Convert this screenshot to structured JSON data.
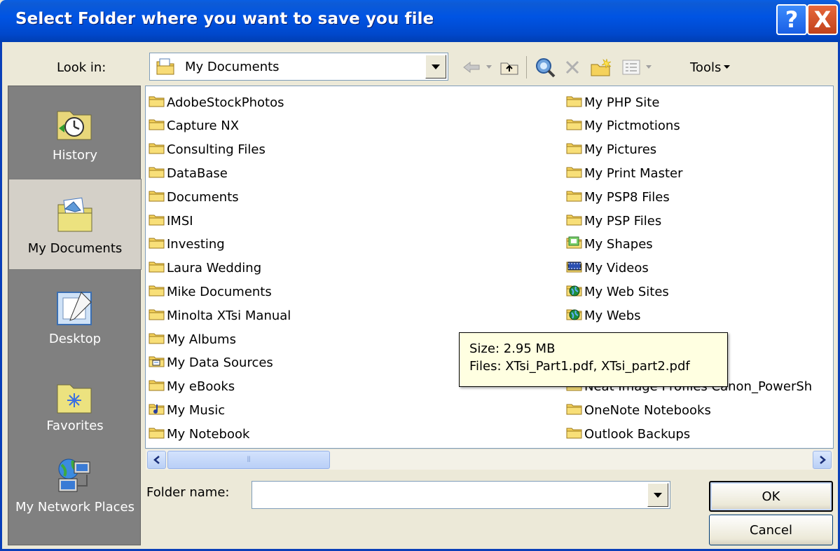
{
  "window": {
    "title": "Select Folder where you want to save you file",
    "help_glyph": "?",
    "close_glyph": "X"
  },
  "lookin": {
    "label": "Look in:",
    "value": "My Documents"
  },
  "toolbar": {
    "tools_label": "Tools"
  },
  "places": [
    {
      "label": "History",
      "icon": "history-icon",
      "selected": false
    },
    {
      "label": "My Documents",
      "icon": "my-documents-icon",
      "selected": true
    },
    {
      "label": "Desktop",
      "icon": "desktop-icon",
      "selected": false
    },
    {
      "label": "Favorites",
      "icon": "favorites-icon",
      "selected": false
    },
    {
      "label": "My Network Places",
      "icon": "network-places-icon",
      "selected": false
    }
  ],
  "files_left": [
    {
      "name": "AdobeStockPhotos",
      "icon": "folder"
    },
    {
      "name": "Capture NX",
      "icon": "folder"
    },
    {
      "name": "Consulting Files",
      "icon": "folder"
    },
    {
      "name": "DataBase",
      "icon": "folder"
    },
    {
      "name": "Documents",
      "icon": "folder"
    },
    {
      "name": "IMSI",
      "icon": "folder"
    },
    {
      "name": "Investing",
      "icon": "folder"
    },
    {
      "name": "Laura Wedding",
      "icon": "folder"
    },
    {
      "name": "Mike Documents",
      "icon": "folder"
    },
    {
      "name": "Minolta XTsi Manual",
      "icon": "folder"
    },
    {
      "name": "My Albums",
      "icon": "folder"
    },
    {
      "name": "My Data Sources",
      "icon": "data-sources-folder"
    },
    {
      "name": "My eBooks",
      "icon": "folder"
    },
    {
      "name": "My Music",
      "icon": "music-folder"
    },
    {
      "name": "My Notebook",
      "icon": "folder"
    }
  ],
  "files_right": [
    {
      "name": "My PHP Site",
      "icon": "folder"
    },
    {
      "name": "My Pictmotions",
      "icon": "folder"
    },
    {
      "name": "My Pictures",
      "icon": "folder"
    },
    {
      "name": "My Print Master",
      "icon": "folder"
    },
    {
      "name": "My PSP8 Files",
      "icon": "folder"
    },
    {
      "name": "My PSP Files",
      "icon": "folder"
    },
    {
      "name": "My Shapes",
      "icon": "shapes-folder"
    },
    {
      "name": "My Videos",
      "icon": "videos-folder"
    },
    {
      "name": "My Web Sites",
      "icon": "web-folder"
    },
    {
      "name": "My Webs",
      "icon": "web-folder"
    },
    {
      "name": "",
      "icon": "folder"
    },
    {
      "name": "",
      "icon": "folder"
    },
    {
      "name": "Neat Image Profiles Canon_PowerSh",
      "icon": "folder"
    },
    {
      "name": "OneNote Notebooks",
      "icon": "folder"
    },
    {
      "name": "Outlook Backups",
      "icon": "folder"
    }
  ],
  "tooltip": {
    "size": "Size: 2.95 MB",
    "files": "Files: XTsi_Part1.pdf, XTsi_part2.pdf"
  },
  "folder_name": {
    "label": "Folder name:",
    "value": ""
  },
  "buttons": {
    "ok": "OK",
    "cancel": "Cancel"
  },
  "colors": {
    "title_bar": "#0054e3",
    "dialog_bg": "#ece9d8",
    "places_bg": "#808080",
    "folder_yellow": "#f5d25b"
  }
}
